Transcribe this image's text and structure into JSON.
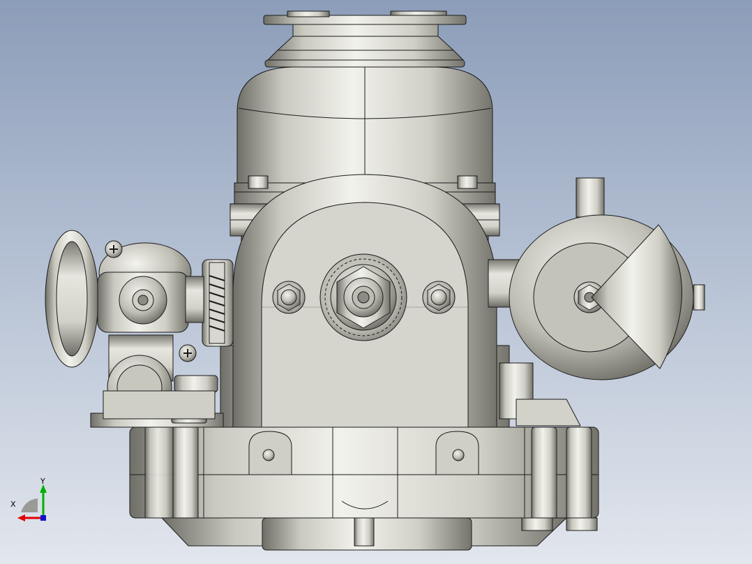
{
  "viewport": {
    "background_top": "#8c9db9",
    "background_bottom": "#e2e6ed"
  },
  "model": {
    "material_light": "#e6e6df",
    "material_mid": "#b9b9b0",
    "material_dark": "#707068",
    "edge_color": "#1a1a1a"
  },
  "triad": {
    "x_label": "X",
    "y_label": "Y",
    "x_color": "#e00000",
    "y_color": "#00b000",
    "z_color": "#1010d0"
  }
}
